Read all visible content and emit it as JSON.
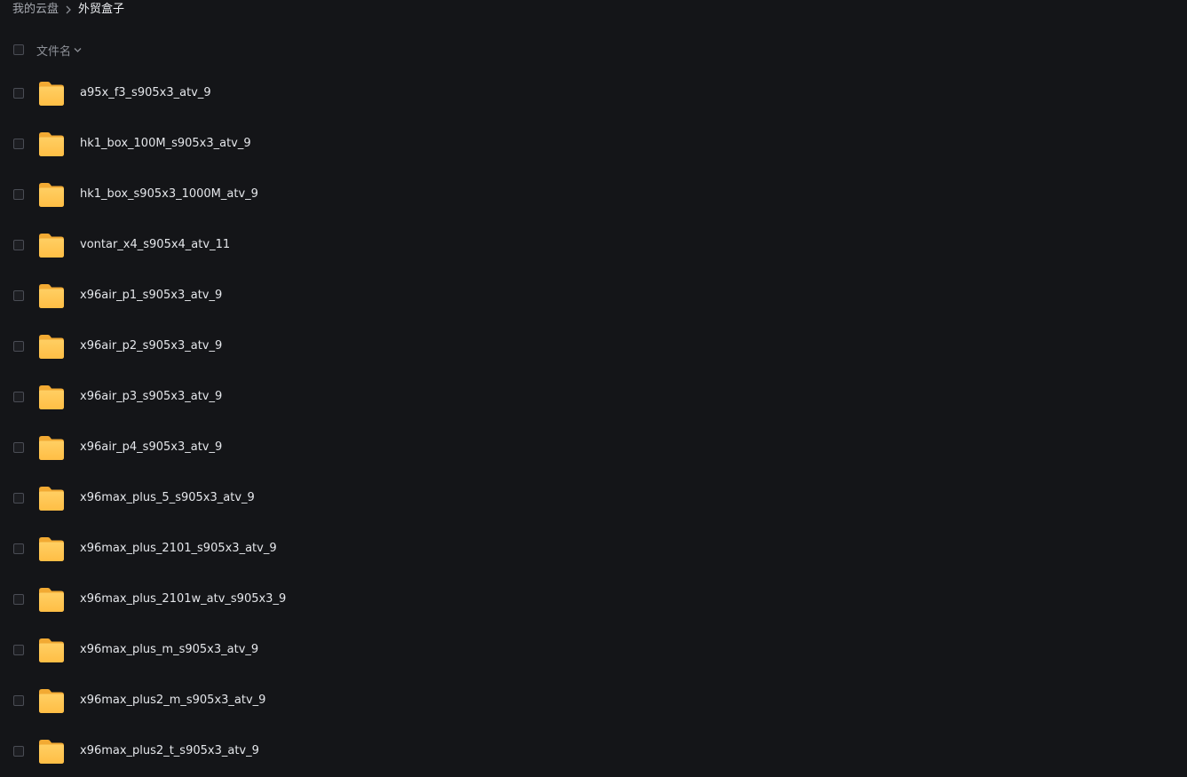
{
  "breadcrumb": {
    "root": "我的云盘",
    "separator_icon": "chevron-right-icon",
    "current": "外贸盒子"
  },
  "list_header": {
    "sort_label": "文件名",
    "sort_icon": "chevron-down-icon"
  },
  "colors": {
    "background": "#141518",
    "folder": "#ffc44d",
    "text": "#e4e6ea"
  },
  "files": [
    {
      "name": "a95x_f3_s905x3_atv_9",
      "icon": "folder-icon"
    },
    {
      "name": "hk1_box_100M_s905x3_atv_9",
      "icon": "folder-icon"
    },
    {
      "name": "hk1_box_s905x3_1000M_atv_9",
      "icon": "folder-icon"
    },
    {
      "name": "vontar_x4_s905x4_atv_11",
      "icon": "folder-icon"
    },
    {
      "name": "x96air_p1_s905x3_atv_9",
      "icon": "folder-icon"
    },
    {
      "name": "x96air_p2_s905x3_atv_9",
      "icon": "folder-icon"
    },
    {
      "name": "x96air_p3_s905x3_atv_9",
      "icon": "folder-icon"
    },
    {
      "name": "x96air_p4_s905x3_atv_9",
      "icon": "folder-icon"
    },
    {
      "name": "x96max_plus_5_s905x3_atv_9",
      "icon": "folder-icon"
    },
    {
      "name": "x96max_plus_2101_s905x3_atv_9",
      "icon": "folder-icon"
    },
    {
      "name": "x96max_plus_2101w_atv_s905x3_9",
      "icon": "folder-icon"
    },
    {
      "name": "x96max_plus_m_s905x3_atv_9",
      "icon": "folder-icon"
    },
    {
      "name": "x96max_plus2_m_s905x3_atv_9",
      "icon": "folder-icon"
    },
    {
      "name": "x96max_plus2_t_s905x3_atv_9",
      "icon": "folder-icon"
    }
  ]
}
